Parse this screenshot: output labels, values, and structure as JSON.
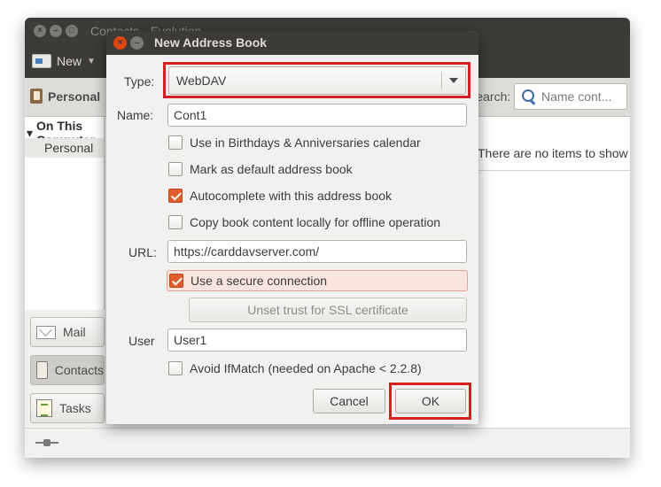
{
  "background_window": {
    "title": "Contacts - Evolution",
    "toolbar_new_label": "New",
    "header_title": "Personal",
    "search_label": "Search:",
    "search_placeholder": "Name cont...",
    "tree_root": "On This Computer",
    "tree_child": "Personal",
    "empty_message": "There are no items to show in this view.",
    "switcher": {
      "mail": "Mail",
      "contacts": "Contacts",
      "tasks": "Tasks"
    }
  },
  "dialog": {
    "title": "New Address Book",
    "type_label": "Type:",
    "type_value": "WebDAV",
    "name_label": "Name:",
    "name_value": "Cont1",
    "checkboxes": {
      "birthdays": {
        "label": "Use in Birthdays & Anniversaries calendar",
        "checked": false
      },
      "default_book": {
        "label": "Mark as default address book",
        "checked": false
      },
      "autocomplete": {
        "label": "Autocomplete with this address book",
        "checked": true
      },
      "offline": {
        "label": "Copy book content locally for offline operation",
        "checked": false
      },
      "secure": {
        "label": "Use a secure connection",
        "checked": true
      },
      "ifmatch": {
        "label": "Avoid IfMatch (needed on Apache < 2.2.8)",
        "checked": false
      }
    },
    "url_label": "URL:",
    "url_value": "https://carddavserver.com/",
    "unset_trust_label": "Unset trust for SSL certificate",
    "user_label": "User",
    "user_value": "User1",
    "cancel_label": "Cancel",
    "ok_label": "OK"
  },
  "colors": {
    "titlebar": "#3c3b37",
    "accent_checkbox": "#e05e2d",
    "highlight_box": "#d42020"
  }
}
